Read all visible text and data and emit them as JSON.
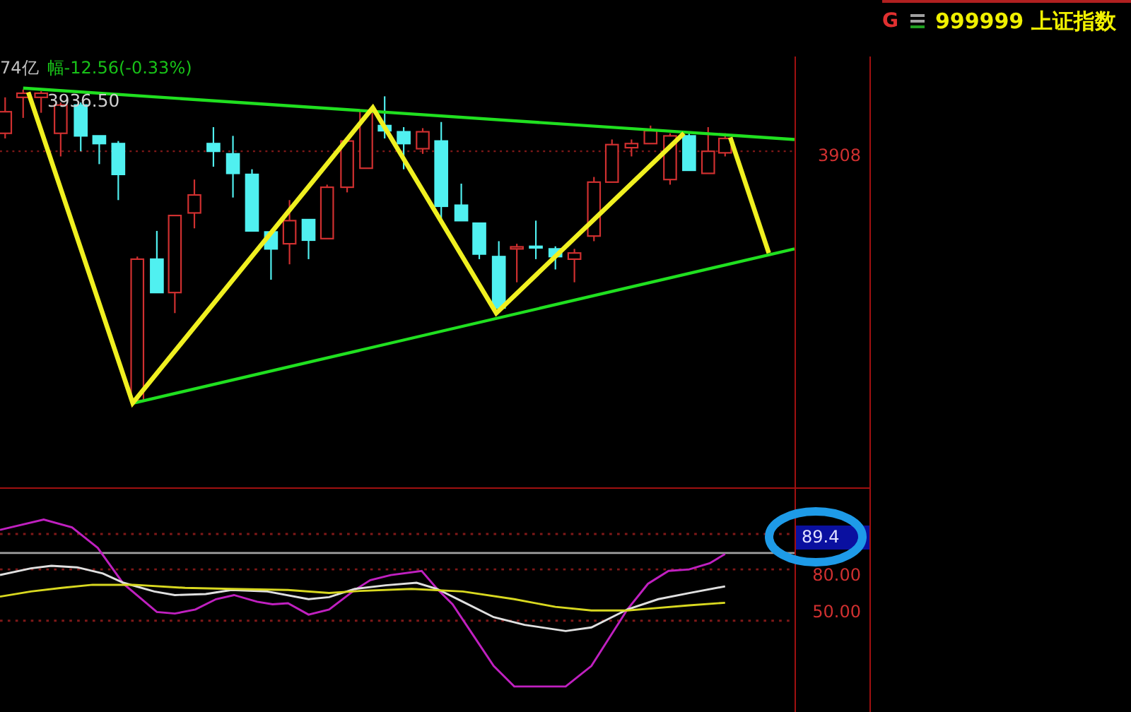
{
  "header": {
    "volume": "74亿",
    "change": "幅-12.56(-0.33%)"
  },
  "title": {
    "prefix": "G",
    "label": "999999 上证指数"
  },
  "main_chart": {
    "high_label": "3936.50",
    "price_axis": [
      "3908"
    ]
  },
  "indicator": {
    "current_value": "89.4",
    "axis": [
      "80.00",
      "50.00"
    ]
  }
}
